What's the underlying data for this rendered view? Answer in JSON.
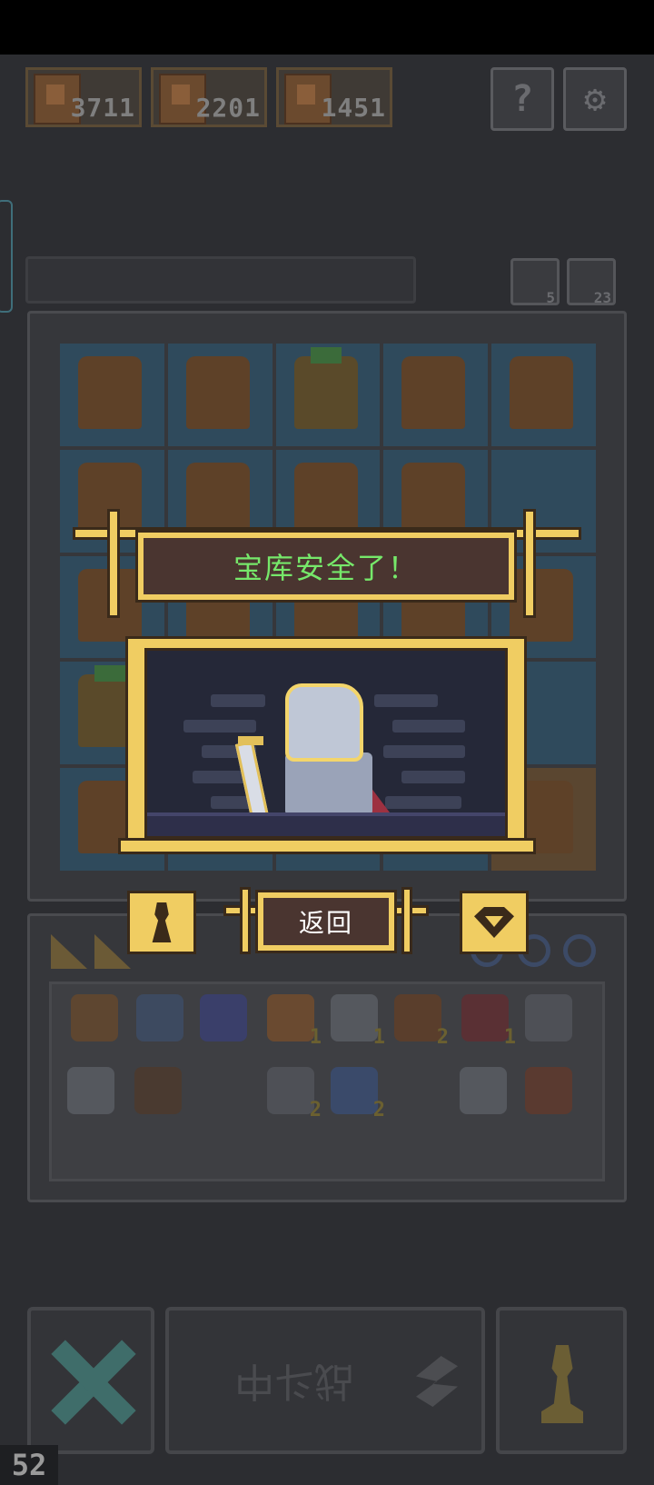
{
  "heroes": [
    {
      "count": "3711"
    },
    {
      "count": "2201"
    },
    {
      "count": "1451"
    }
  ],
  "top_buttons": {
    "help_icon": "?",
    "settings_icon": "gear-icon"
  },
  "side_buttons": [
    {
      "icon": "swap-icon",
      "count": "5"
    },
    {
      "icon": "key-icon",
      "count": "23"
    }
  ],
  "dialog": {
    "title": "宝库安全了！",
    "back_label": "返回",
    "left_icon": "keyhole-icon",
    "right_icon": "gem-icon"
  },
  "inventory": {
    "quantities": [
      "1",
      "1",
      "2",
      "1",
      "2",
      "2"
    ]
  },
  "bottom": {
    "battle_label": "战斗中",
    "fps": "52"
  },
  "colors": {
    "accent_gold": "#f0cd62",
    "title_green": "#76e86a",
    "banner_brown": "#4a3530"
  }
}
